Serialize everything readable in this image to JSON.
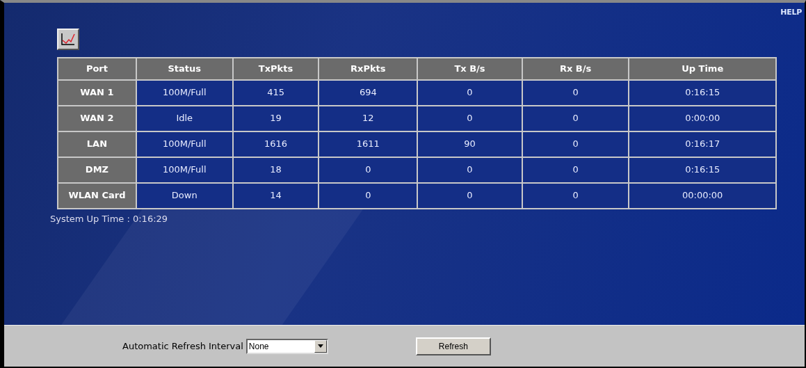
{
  "help_link": "HELP",
  "table": {
    "columns": [
      "Port",
      "Status",
      "TxPkts",
      "RxPkts",
      "Tx B/s",
      "Rx B/s",
      "Up Time"
    ],
    "rows": [
      [
        "WAN 1",
        "100M/Full",
        "415",
        "694",
        "0",
        "0",
        "0:16:15"
      ],
      [
        "WAN 2",
        "Idle",
        "19",
        "12",
        "0",
        "0",
        "0:00:00"
      ],
      [
        "LAN",
        "100M/Full",
        "1616",
        "1611",
        "90",
        "0",
        "0:16:17"
      ],
      [
        "DMZ",
        "100M/Full",
        "18",
        "0",
        "0",
        "0",
        "0:16:15"
      ],
      [
        "WLAN Card",
        "Down",
        "14",
        "0",
        "0",
        "0",
        "00:00:00"
      ]
    ]
  },
  "system_up_time": "System Up Time : 0:16:29",
  "refresh_interval": {
    "label": "Automatic Refresh Interval",
    "value": "None"
  },
  "refresh_button": "Refresh"
}
